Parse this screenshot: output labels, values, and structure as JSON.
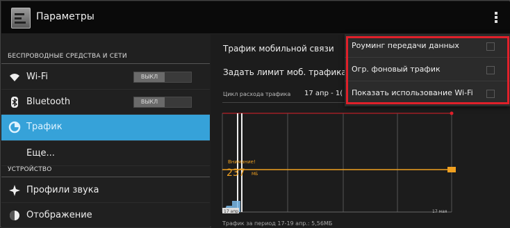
{
  "app": {
    "title": "Параметры",
    "icon": "settings-icon"
  },
  "sidebar": {
    "wireless_header": "БЕСПРОВОДНЫЕ СРЕДСТВА И СЕТИ",
    "device_header": "УСТРОЙСТВО",
    "items": [
      {
        "label": "Wi-Fi",
        "icon": "wifi-icon",
        "toggle": "ВЫКЛ"
      },
      {
        "label": "Bluetooth",
        "icon": "bluetooth-icon",
        "toggle": "ВЫКЛ"
      },
      {
        "label": "Трафик",
        "icon": "data-usage-icon",
        "selected": true
      },
      {
        "label": "Еще..."
      },
      {
        "label": "Профили звука",
        "icon": "sound-icon"
      },
      {
        "label": "Отображение",
        "icon": "display-icon"
      }
    ]
  },
  "main": {
    "mobile_data": "Трафик мобильной связи",
    "set_limit": "Задать лимит моб. трафика",
    "cycle_label": "Цикл расхода трафика",
    "cycle_value": "17 апр - 1(",
    "warning_label": "Внимание!",
    "warning_value": "237",
    "warning_unit": "МБ",
    "x_start": "17 апр",
    "x_end": "17 мая",
    "footer": "Трафик за период 17-19 апр.: 5,56МБ"
  },
  "menu": {
    "items": [
      {
        "label": "Роуминг передачи данных"
      },
      {
        "label": "Огр. фоновый трафик"
      },
      {
        "label": "Показать использование Wi-Fi"
      }
    ]
  },
  "colors": {
    "accent": "#36a2d9",
    "warning_line": "#f0a020",
    "limit_line": "#e0202a",
    "highlight": "#e0202a"
  }
}
